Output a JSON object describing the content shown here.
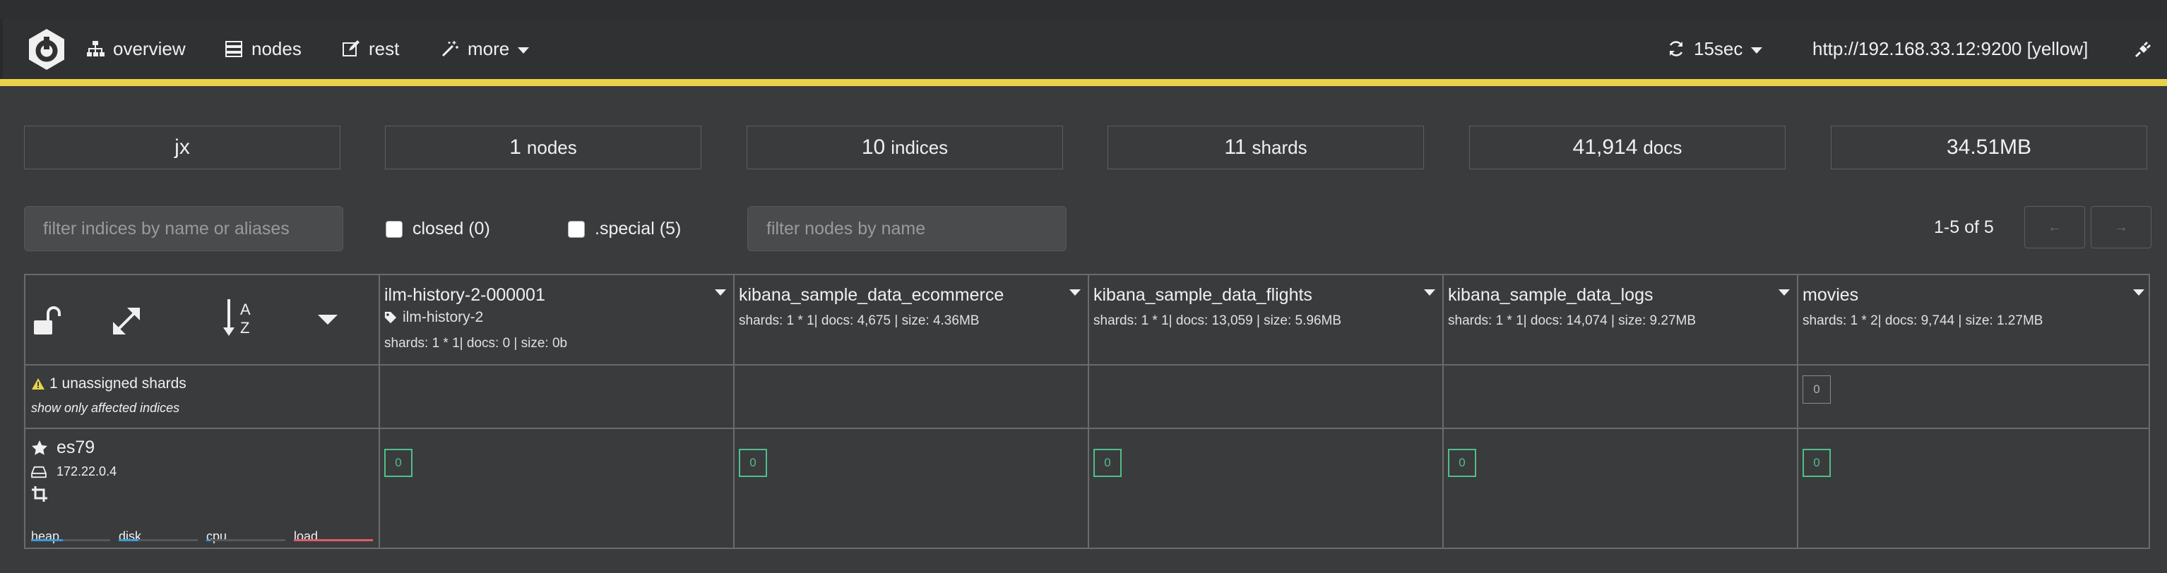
{
  "colors": {
    "accent_yellow": "#e8d24a",
    "shard_green": "#4fbf8a",
    "load_red": "#e05c6a",
    "metric_blue": "#3a9bd9"
  },
  "navbar": {
    "logo": "cerebro-logo",
    "items": [
      {
        "label": "overview",
        "icon": "sitemap-icon"
      },
      {
        "label": "nodes",
        "icon": "server-icon"
      },
      {
        "label": "rest",
        "icon": "edit-icon"
      },
      {
        "label": "more",
        "icon": "magic-wand-icon"
      }
    ],
    "refresh": "15sec",
    "cluster_url": "http://192.168.33.12:9200 [yellow]"
  },
  "stats": [
    {
      "value": "jx",
      "unit": ""
    },
    {
      "value": "1",
      "unit": "nodes"
    },
    {
      "value": "10",
      "unit": "indices"
    },
    {
      "value": "11",
      "unit": "shards"
    },
    {
      "value": "41,914",
      "unit": "docs"
    },
    {
      "value": "34.51MB",
      "unit": ""
    }
  ],
  "filters": {
    "indices_placeholder": "filter indices by name or aliases",
    "closed_label": "closed (0)",
    "special_label": ".special (5)",
    "nodes_placeholder": "filter nodes by name",
    "page_info": "1-5 of 5",
    "prev_label": "←",
    "next_label": "→"
  },
  "unassigned": {
    "count_text": "1 unassigned shards",
    "link_text": "show only affected indices"
  },
  "indices": [
    {
      "name": "ilm-history-2-000001",
      "alias": "ilm-history-2",
      "meta": "shards: 1 * 1| docs: 0 | size: 0b",
      "unassigned": "",
      "shard": "0"
    },
    {
      "name": "kibana_sample_data_ecommerce",
      "alias": "",
      "meta": "shards: 1 * 1| docs: 4,675 | size: 4.36MB",
      "unassigned": "",
      "shard": "0"
    },
    {
      "name": "kibana_sample_data_flights",
      "alias": "",
      "meta": "shards: 1 * 1| docs: 13,059 | size: 5.96MB",
      "unassigned": "",
      "shard": "0"
    },
    {
      "name": "kibana_sample_data_logs",
      "alias": "",
      "meta": "shards: 1 * 1| docs: 14,074 | size: 9.27MB",
      "unassigned": "",
      "shard": "0"
    },
    {
      "name": "movies",
      "alias": "",
      "meta": "shards: 1 * 2| docs: 9,744 | size: 1.27MB",
      "unassigned": "0",
      "shard": "0"
    }
  ],
  "node": {
    "name": "es79",
    "ip": "172.22.0.4",
    "metrics": [
      {
        "label": "heap",
        "fraction": 0.4
      },
      {
        "label": "disk",
        "fraction": 0.25
      },
      {
        "label": "cpu",
        "fraction": 0.05
      },
      {
        "label": "load",
        "fraction": 1.0
      }
    ]
  }
}
